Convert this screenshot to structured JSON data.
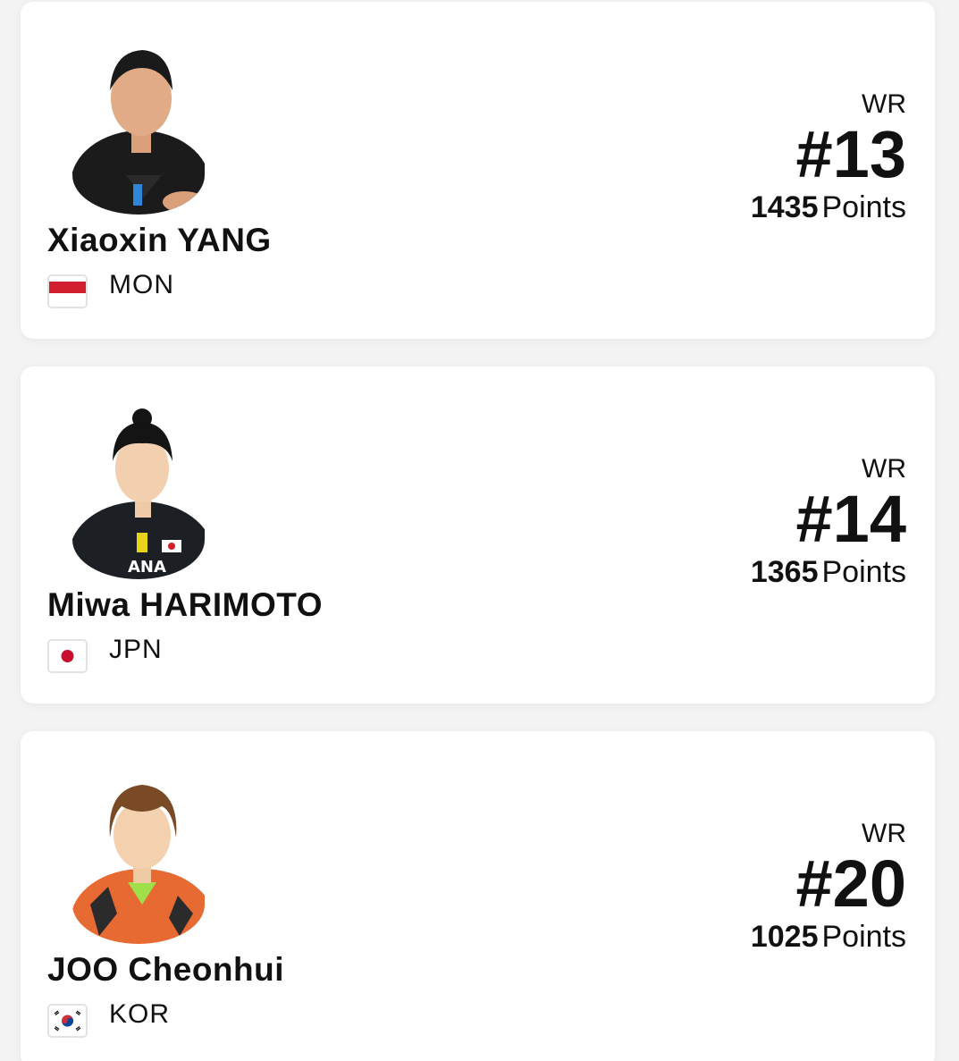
{
  "players": [
    {
      "name": "Xiaoxin YANG",
      "country": "MON",
      "flag": "indonesia-like-red-white-flag",
      "wr_label": "WR",
      "rank": "#13",
      "points": "1435",
      "points_label": "Points"
    },
    {
      "name": "Miwa HARIMOTO",
      "country": "JPN",
      "flag": "japan-flag",
      "wr_label": "WR",
      "rank": "#14",
      "points": "1365",
      "points_label": "Points"
    },
    {
      "name": "JOO Cheonhui",
      "country": "KOR",
      "flag": "south-korea-flag",
      "wr_label": "WR",
      "rank": "#20",
      "points": "1025",
      "points_label": "Points"
    }
  ],
  "colors": {
    "card_bg": "#ffffff",
    "page_bg": "#f3f3f3",
    "text": "#111111",
    "flag_red": "#d21f2e"
  }
}
